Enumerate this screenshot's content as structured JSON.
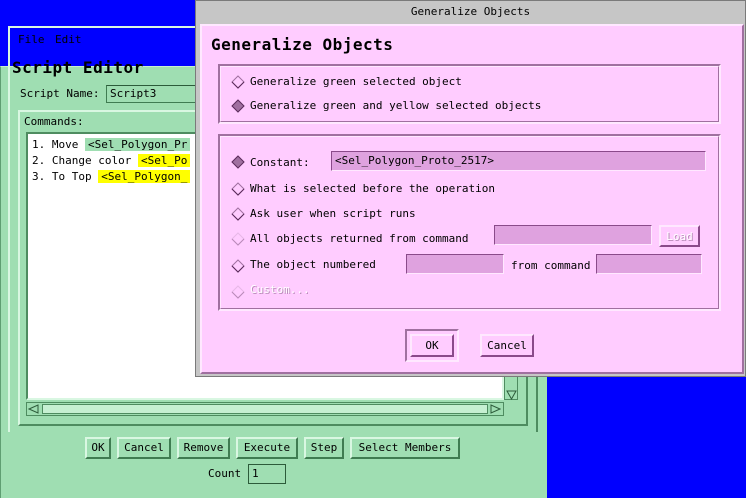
{
  "script_editor": {
    "menu": [
      "File",
      "Edit"
    ],
    "title": "Script Editor",
    "script_name_label": "Script Name:",
    "script_name_value": "Script3",
    "commands_label": "Commands:",
    "commands": [
      {
        "num": "1.",
        "action": "Move",
        "target": "<Sel_Polygon_Pr",
        "color": "green"
      },
      {
        "num": "2.",
        "action": "Change color",
        "target": "<Sel_Po",
        "color": "yellow"
      },
      {
        "num": "3.",
        "action": "To Top",
        "target": "<Sel_Polygon_",
        "color": "yellow"
      }
    ],
    "buttons": [
      "OK",
      "Cancel",
      "Remove",
      "Execute",
      "Step",
      "Select Members"
    ],
    "count_label": "Count",
    "count_value": "1"
  },
  "generalize": {
    "window_title": "Generalize Objects",
    "heading": "Generalize Objects",
    "scope_options": [
      {
        "label": "Generalize green selected object",
        "selected": false
      },
      {
        "label": "Generalize green and yellow selected objects",
        "selected": true
      }
    ],
    "constant_label": "Constant:",
    "constant_value": "<Sel_Polygon_Proto_2517>",
    "what_selected_label": "What is selected before the operation",
    "ask_user_label": "Ask user when script runs",
    "all_objects_label": "All objects returned from command",
    "load_label": "Load",
    "numbered_label": "The object numbered",
    "from_command_label": "from command",
    "custom_label": "Custom...",
    "ok_label": "OK",
    "cancel_label": "Cancel"
  },
  "colors": {
    "desktop_blue": "#0000ff",
    "editor_green": "#9fdeb2",
    "dialog_pink": "#ffccff",
    "tag_yellow": "#ffff00",
    "field_pink": "#dfa2df"
  }
}
